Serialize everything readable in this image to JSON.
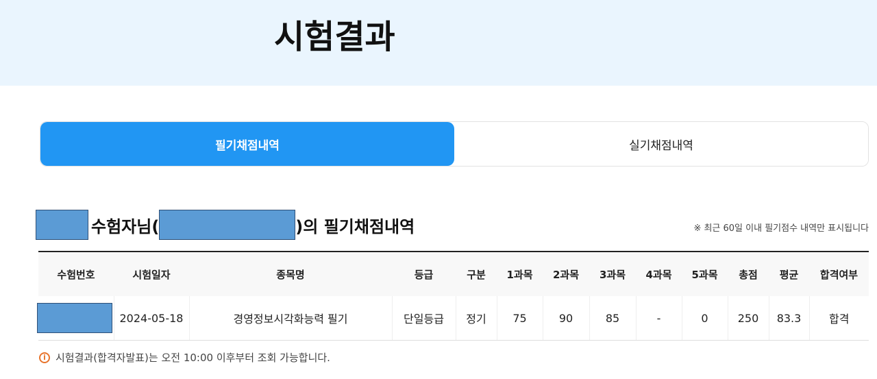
{
  "header": {
    "title": "시험결과"
  },
  "tabs": [
    {
      "label": "필기채점내역",
      "active": true
    },
    {
      "label": "실기채점내역",
      "active": false
    }
  ],
  "section": {
    "heading_mid": "수험자님(",
    "heading_end": ")의 필기채점내역",
    "notice": "※ 최근 60일 이내 필기점수 내역만 표시됩니다"
  },
  "table": {
    "headers": [
      "수험번호",
      "시험일자",
      "종목명",
      "등급",
      "구분",
      "1과목",
      "2과목",
      "3과목",
      "4과목",
      "5과목",
      "총점",
      "평균",
      "합격여부"
    ],
    "rows": [
      {
        "exam_date": "2024-05-18",
        "subject": "경영정보시각화능력 필기",
        "grade": "단일등급",
        "type": "정기",
        "s1": "75",
        "s2": "90",
        "s3": "85",
        "s4": "-",
        "s5": "0",
        "total": "250",
        "average": "83.3",
        "result": "합격"
      }
    ]
  },
  "footnote": {
    "icon": "info-icon",
    "text": "시험결과(합격자발표)는 오전 10:00 이후부터 조회 가능합니다."
  },
  "colors": {
    "accent": "#2196f3",
    "hero_bg": "#eaf5fe",
    "mask": "#5b9bd5",
    "warning": "#e8742c"
  }
}
